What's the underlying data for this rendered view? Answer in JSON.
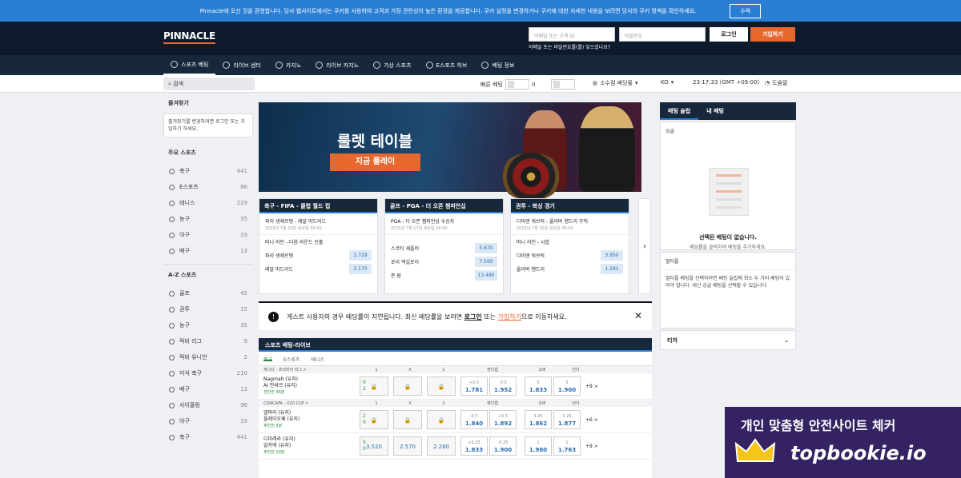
{
  "cookie": {
    "text": "Pinnacle에 오신 것을 환영합니다. 당사 웹사이트에서는 쿠키를 사용하여 고객과 가장 관련성이 높은 환경을 제공합니다. 쿠키 설정을 변경하거나 쿠키에 대한 자세한 내용을 보려면 당사의 쿠키 정책을 확인하세요.",
    "accept": "수락"
  },
  "header": {
    "logo": "PINNACLE",
    "id_placeholder": "이메일 또는 고객 ID",
    "pw_placeholder": "비밀번호",
    "login": "로그인",
    "join": "가입하기",
    "forgot": "이메일 또는 비밀번호를(를) 잊으셨나요?"
  },
  "nav": [
    "스포츠 베팅",
    "라이브 센터",
    "카지노",
    "라이브 카지노",
    "가상 스포츠",
    "E스포츠 허브",
    "베팅 정보"
  ],
  "toolbar": {
    "search": "검색",
    "quick_bet": "빠른 베팅",
    "quick_bet_value": "0",
    "odds_format": "소수점 배당률",
    "lang": "KO",
    "time": "23:17:33 (GMT +09:00)",
    "help": "도움말"
  },
  "sidebar": {
    "fav_title": "즐겨찾기",
    "fav_note": "즐겨찾기를 변경하려면 로그인 또는 가입하기 하세요.",
    "main_title": "주요 스포츠",
    "main": [
      {
        "name": "축구",
        "count": "441"
      },
      {
        "name": "E스포츠",
        "count": "86"
      },
      {
        "name": "테니스",
        "count": "229"
      },
      {
        "name": "농구",
        "count": "35"
      },
      {
        "name": "야구",
        "count": "33"
      },
      {
        "name": "배구",
        "count": "13"
      }
    ],
    "az_title": "A-Z 스포츠",
    "az": [
      {
        "name": "골프",
        "count": "45"
      },
      {
        "name": "권투",
        "count": "15"
      },
      {
        "name": "농구",
        "count": "35"
      },
      {
        "name": "럭비 리그",
        "count": "9"
      },
      {
        "name": "럭비 유니언",
        "count": "2"
      },
      {
        "name": "미식 축구",
        "count": "210"
      },
      {
        "name": "배구",
        "count": "13"
      },
      {
        "name": "사이클링",
        "count": "96"
      },
      {
        "name": "야구",
        "count": "33"
      },
      {
        "name": "축구",
        "count": "441"
      }
    ]
  },
  "banner": {
    "title": "룰렛 테이블",
    "button": "지금 플레이"
  },
  "cards": [
    {
      "header": "축구 - FIFA - 클럽 월드 컵",
      "title": "파리 생제르맹 - 레알 마드리드",
      "date": "2025년 7월 10일 목요일 04:00",
      "sub": "머니 라인 - 다음 라운드 진출",
      "odds": [
        {
          "label": "파리 생제르맹",
          "value": "1.729"
        },
        {
          "label": "레알 마드리드",
          "value": "2.170"
        }
      ]
    },
    {
      "header": "골프 - PGA - 더 오픈 챔피언십",
      "title": "PGA - 더 오픈 챔피언십 우승자",
      "date": "2025년 7월 17일 목요일 16:00",
      "sub": "",
      "odds": [
        {
          "label": "스코티 셰플러",
          "value": "5.670"
        },
        {
          "label": "로리 맥길로이",
          "value": "7.560"
        },
        {
          "label": "존 람",
          "value": "13.490"
        }
      ]
    },
    {
      "header": "권투 - 복싱 경기",
      "title": "다미엔 워브릭 - 올리버 헨드리 무직",
      "date": "2025년 7월 20일 일요일 06:00",
      "sub": "머니 라인 - 시합",
      "odds": [
        {
          "label": "다미엔 워브릭",
          "value": "3.950"
        },
        {
          "label": "올리버 헨드리",
          "value": "1.281"
        }
      ]
    }
  ],
  "notice": {
    "pre": "게스트 사용자의 경우 배당률이 지연됩니다. 최신 배당률을 보려면",
    "login": "로그인",
    "mid": "또는",
    "join": "가입하기",
    "post": "으로 이동하세요."
  },
  "live": {
    "title": "스포츠 베팅-라이브",
    "tabs": [
      "축구",
      "E스포츠",
      "테니스"
    ],
    "col_1": "1",
    "col_x": "X",
    "col_2": "2",
    "col_hcp": "핸디캡",
    "col_ou": "오버",
    "col_under": "언더",
    "league1": "캐나다 - 프리미어 리그 >",
    "league2": "CONCAFA - U20 CUP >",
    "matches": [
      {
        "home": "Nagmah (유지)",
        "away": "AI 안싸르 (유지)",
        "time": "전반전 36분",
        "s1": "0",
        "s2": "2",
        "o1": "",
        "ox": "",
        "o2": "",
        "h1a": "+0.5",
        "h1b": "1.781",
        "h2a": "-0.5",
        "h2b": "1.952",
        "ou1a": "5",
        "ou1b": "1.833",
        "ou2a": "5",
        "ou2b": "1.900",
        "more": "+9 >"
      },
      {
        "home": "엘파라 (유지)",
        "away": "플레이오페 (유지)",
        "time": "후반전 3분",
        "s1": "2",
        "s2": "0",
        "o1": "",
        "ox": "",
        "o2": "",
        "h1a": "-0.5",
        "h1b": "1.840",
        "h2a": "+0.5",
        "h2b": "1.892",
        "ou1a": "3.25",
        "ou1b": "1.862",
        "ou2a": "3.25",
        "ou2b": "1.877",
        "more": "+6 >"
      },
      {
        "home": "디미레라 (유지)",
        "away": "알카에 (유지)",
        "time": "후반전 10분",
        "s1": "0",
        "s2": "0",
        "o1": "3.520",
        "ox": "2.570",
        "o2": "2.260",
        "h1a": "+0.25",
        "h1b": "1.833",
        "h2a": "-0.25",
        "h2b": "1.900",
        "ou1a": "1",
        "ou1b": "1.980",
        "ou2a": "1",
        "ou2b": "1.763",
        "more": "+9 >"
      }
    ]
  },
  "betslip": {
    "tab1": "베팅 슬립",
    "tab2": "내 베팅",
    "single": "싱글",
    "empty_title": "선택된 베팅이 없습니다.",
    "empty_sub": "배당률을 클릭하여 베팅을 추가하세요.",
    "multi_title": "멀티플",
    "multi_text": "멀티플 베팅을 선택하려면 베팅 슬립에 최소 두 가지 베팅이 있어야 합니다. 대신 싱글 베팅을 선택할 수 있습니다.",
    "teaser": "티저"
  },
  "ad": {
    "top": "개인 맞춤형 안전사이트 체커",
    "main": "topbookie.io"
  }
}
